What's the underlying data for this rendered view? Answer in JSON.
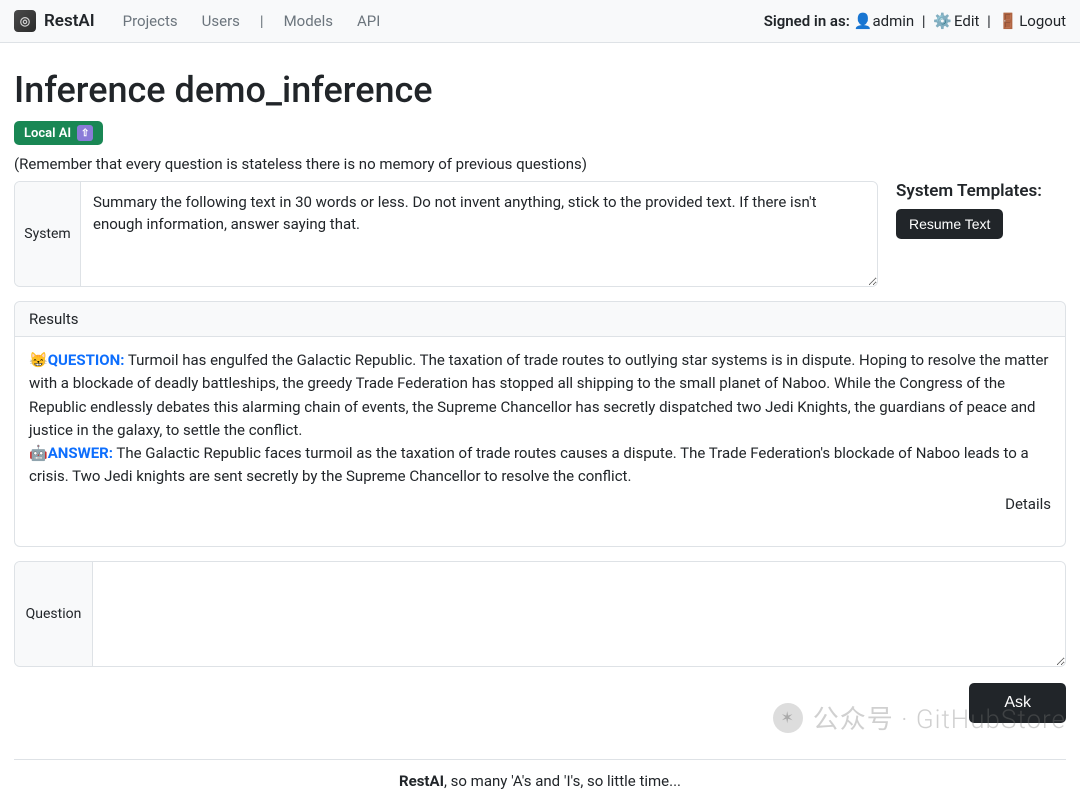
{
  "nav": {
    "brand": "RestAI",
    "links": {
      "projects": "Projects",
      "users": "Users",
      "models": "Models",
      "api": "API"
    },
    "signed_in_label": "Signed in as:",
    "user": "admin",
    "edit": "Edit",
    "logout": "Logout"
  },
  "page": {
    "title": "Inference demo_inference",
    "badge_label": "Local AI",
    "hint": "(Remember that every question is stateless there is no memory of previous questions)"
  },
  "system": {
    "label": "System",
    "value": "Summary the following text in 30 words or less. Do not invent anything, stick to the provided text. If there isn't enough information, answer saying that."
  },
  "templates": {
    "heading": "System Templates:",
    "resume_text": "Resume Text"
  },
  "results": {
    "header": "Results",
    "question_label": "QUESTION:",
    "question_text": " Turmoil has engulfed the Galactic Republic. The taxation of trade routes to outlying star systems is in dispute. Hoping to resolve the matter with a blockade of deadly battleships, the greedy Trade Federation has stopped all shipping to the small planet of Naboo. While the Congress of the Republic endlessly debates this alarming chain of events, the Supreme Chancellor has secretly dispatched two Jedi Knights, the guardians of peace and justice in the galaxy, to settle the conflict.",
    "answer_label": "ANSWER:",
    "answer_text": " The Galactic Republic faces turmoil as the taxation of trade routes causes a dispute. The Trade Federation's blockade of Naboo leads to a crisis. Two Jedi knights are sent secretly by the Supreme Chancellor to resolve the conflict.",
    "details": "Details"
  },
  "question": {
    "label": "Question",
    "value": ""
  },
  "actions": {
    "ask": "Ask"
  },
  "footer": {
    "brand": "RestAI",
    "tagline": ", so many 'A's and 'I's, so little time..."
  },
  "watermark": {
    "text": "公众号 · GitHubStore"
  }
}
